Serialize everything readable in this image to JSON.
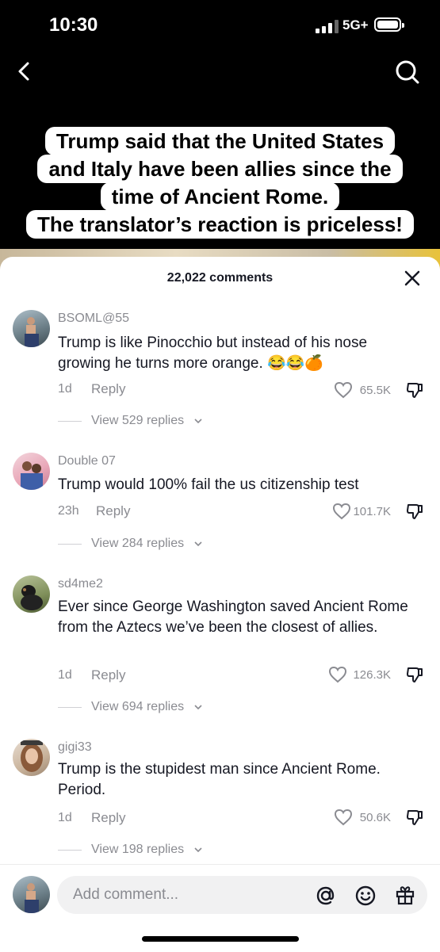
{
  "status": {
    "time": "10:30",
    "network": "5G+"
  },
  "caption": {
    "lines": [
      "Trump said that the United States",
      "and Italy have been allies since the",
      "time of Ancient Rome.",
      "The translator’s reaction is priceless!"
    ]
  },
  "sheet": {
    "title": "22,022 comments"
  },
  "comments": [
    {
      "user": "BSOML@55",
      "text": "Trump is like Pinocchio but instead of his nose growing he turns more orange. 😂😂🍊",
      "age": "1d",
      "reply": "Reply",
      "likes": "65.5K",
      "view_replies": "View 529 replies"
    },
    {
      "user": "Double 07",
      "text": "Trump would 100% fail the us citizenship test",
      "age": "23h",
      "reply": "Reply",
      "likes": "101.7K",
      "view_replies": "View 284 replies"
    },
    {
      "user": "sd4me2",
      "text": "Ever since George Washington saved Ancient Rome from the Aztecs we’ve been the closest of allies.",
      "age": "1d",
      "reply": "Reply",
      "likes": "126.3K",
      "view_replies": "View 694 replies"
    },
    {
      "user": "gigi33",
      "text": "Trump is the stupidest man since Ancient Rome. Period.",
      "age": "1d",
      "reply": "Reply",
      "likes": "50.6K",
      "view_replies": "View 198 replies"
    }
  ],
  "composer": {
    "placeholder": "Add comment..."
  },
  "icons": [
    "back-icon",
    "search-icon",
    "close-icon",
    "heart-icon",
    "dislike-icon",
    "chevron-down-icon",
    "at-icon",
    "emoji-icon",
    "gift-icon"
  ]
}
